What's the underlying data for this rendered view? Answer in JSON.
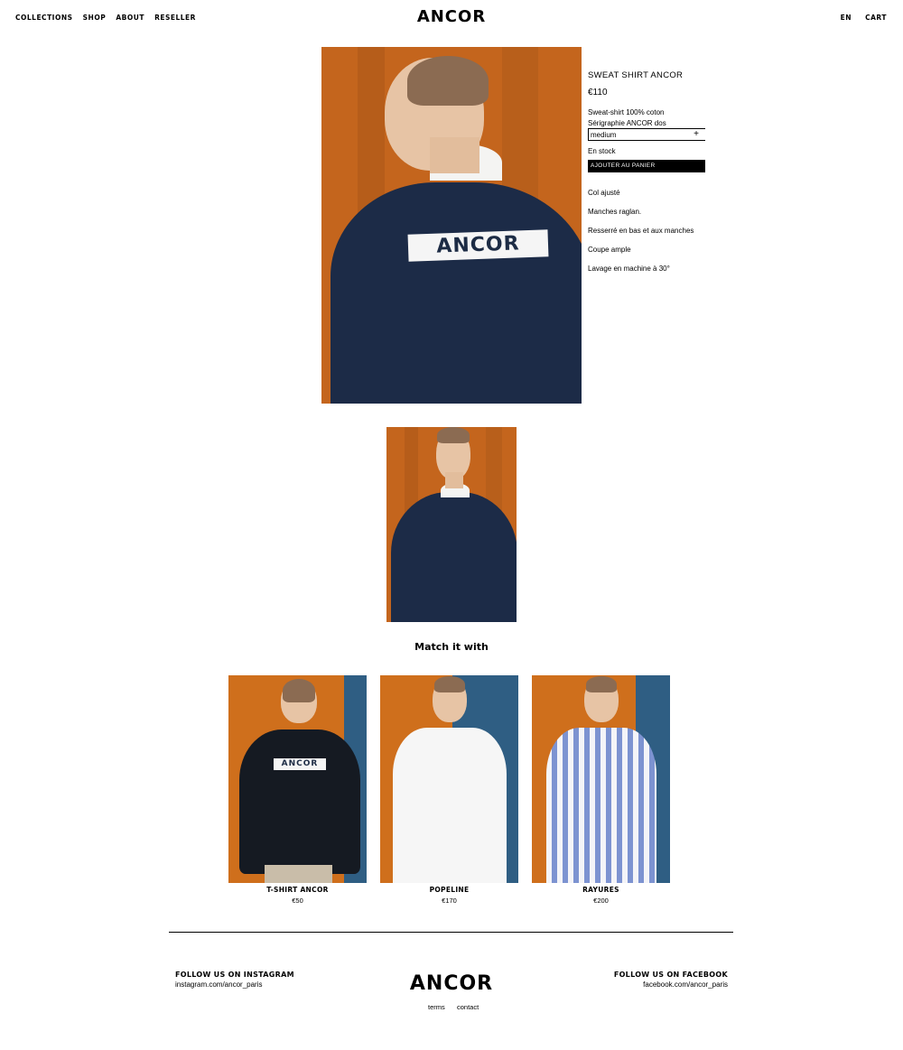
{
  "header": {
    "nav_left": [
      "COLLECTIONS",
      "SHOP",
      "ABOUT",
      "RESELLER"
    ],
    "logo": "ANCOR",
    "lang": "EN",
    "cart": "CART"
  },
  "product": {
    "title": "SWEAT SHIRT ANCOR",
    "price": "€110",
    "desc_line1": "Sweat-shirt 100% coton",
    "desc_line2": "Sérigraphie ANCOR dos",
    "size_value": "medium",
    "size_toggle": "+",
    "stock": "En stock",
    "add_to_cart": "AJOUTER AU PANIER",
    "features": [
      "Col ajusté",
      "Manches raglan.",
      "Resserré en bas et aux manches",
      "Coupe ample",
      "Lavage en machine à 30°"
    ],
    "print_text": "ANCOR"
  },
  "match": {
    "title": "Match it with",
    "items": [
      {
        "name": "T-SHIRT ANCOR",
        "price": "€50",
        "print_text": "ANCOR"
      },
      {
        "name": "POPELINE",
        "price": "€170"
      },
      {
        "name": "RAYURES",
        "price": "€200"
      }
    ]
  },
  "footer": {
    "instagram_label": "FOLLOW US ON INSTAGRAM",
    "instagram_link": "instagram.com/ancor_paris",
    "logo": "ANCOR",
    "facebook_label": "FOLLOW US ON FACEBOOK",
    "facebook_link": "facebook.com/ancor_paris",
    "terms": "terms",
    "contact": "contact"
  },
  "colors": {
    "backdrop_orange": "#c4651d",
    "backdrop_blue": "#2f5e83",
    "navy": "#1c2b47"
  }
}
